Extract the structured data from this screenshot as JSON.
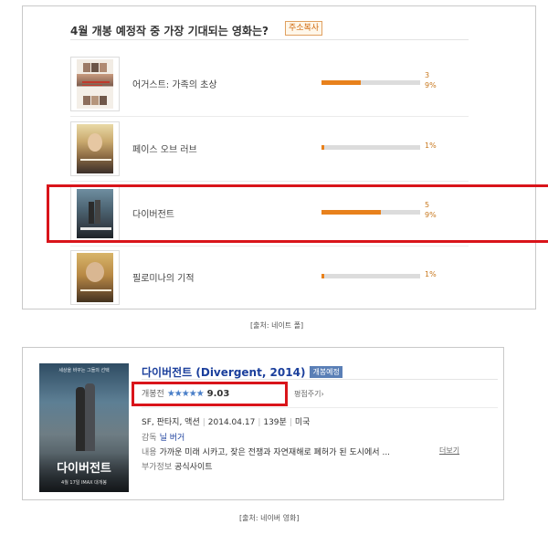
{
  "poll": {
    "title": "4월 개봉 예정작 중 가장 기대되는 영화는?",
    "copy_button": "주소복사",
    "items": [
      {
        "title": "어거스트: 가족의 초상",
        "count": "3",
        "percent": "9%",
        "fill": 0.4
      },
      {
        "title": "페이스 오브 러브",
        "count": "",
        "percent": "1%",
        "fill": 0.03
      },
      {
        "title": "다이버전트",
        "count": "5",
        "percent": "9%",
        "fill": 0.6
      },
      {
        "title": "필로미나의 기적",
        "count": "",
        "percent": "1%",
        "fill": 0.03
      }
    ],
    "highlight_color": "#d9141a",
    "bar_color": "#e8811c",
    "caption": "[출처: 네이트 폴]"
  },
  "movie": {
    "title": "다이버전트 (Divergent, 2014)",
    "badge": "개봉예정",
    "rating_label": "개봉전",
    "stars": "★★★★★",
    "rating_value": "9.03",
    "rate_link": "평점주기›",
    "info": {
      "genres": "SF, 판타지, 액션",
      "release_date": "2014.04.17",
      "runtime": "139분",
      "country": "미국"
    },
    "director_label": "감독",
    "director": "닐 버거",
    "content_label": "내용",
    "content": "가까운 미래 시카고, 잦은 전쟁과 자연재해로 폐허가 된 도시에서 ...",
    "more_link": "더보기",
    "extra_label": "부가정보",
    "official_site": "공식사이트",
    "poster_text": {
      "title": "다이버전트",
      "tagline": "세상을 바꾸는 그들의 선택",
      "footer": "4월 17일 IMAX 대개봉"
    },
    "caption": "[출처: 네이버 영화]",
    "title_color": "#1b3f9c"
  }
}
